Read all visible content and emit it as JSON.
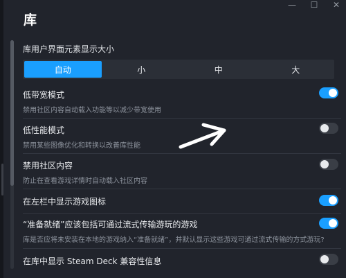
{
  "window": {
    "title": "库",
    "controls": {
      "minimize": "—",
      "maximize": "☐",
      "close": "✕"
    }
  },
  "ui_size": {
    "label": "库用户界面元素显示大小",
    "options": [
      "自动",
      "小",
      "中",
      "大"
    ],
    "selected": "自动"
  },
  "settings": [
    {
      "title": "低带宽模式",
      "desc": "禁用社区内容自动载入功能等以减少带宽使用",
      "enabled": true
    },
    {
      "title": "低性能模式",
      "desc": "禁用某些图像优化和转换以改善库性能",
      "enabled": false
    },
    {
      "title": "禁用社区内容",
      "desc": "防止在查看游戏详情时自动载入社区内容",
      "enabled": false
    },
    {
      "title": "在左栏中显示游戏图标",
      "desc": "",
      "enabled": true
    },
    {
      "title": "“准备就绪”应该包括可通过流式传输游玩的游戏",
      "desc": "库是否应将未安装在本地的游戏纳入“准备就绪”，并默认显示这些游戏可通过流式传输的方式游玩?",
      "enabled": true
    },
    {
      "title": "在库中显示 Steam Deck 兼容性信息",
      "desc": "",
      "enabled": false
    }
  ],
  "colors": {
    "accent": "#1a9fff",
    "background": "#21242c"
  }
}
